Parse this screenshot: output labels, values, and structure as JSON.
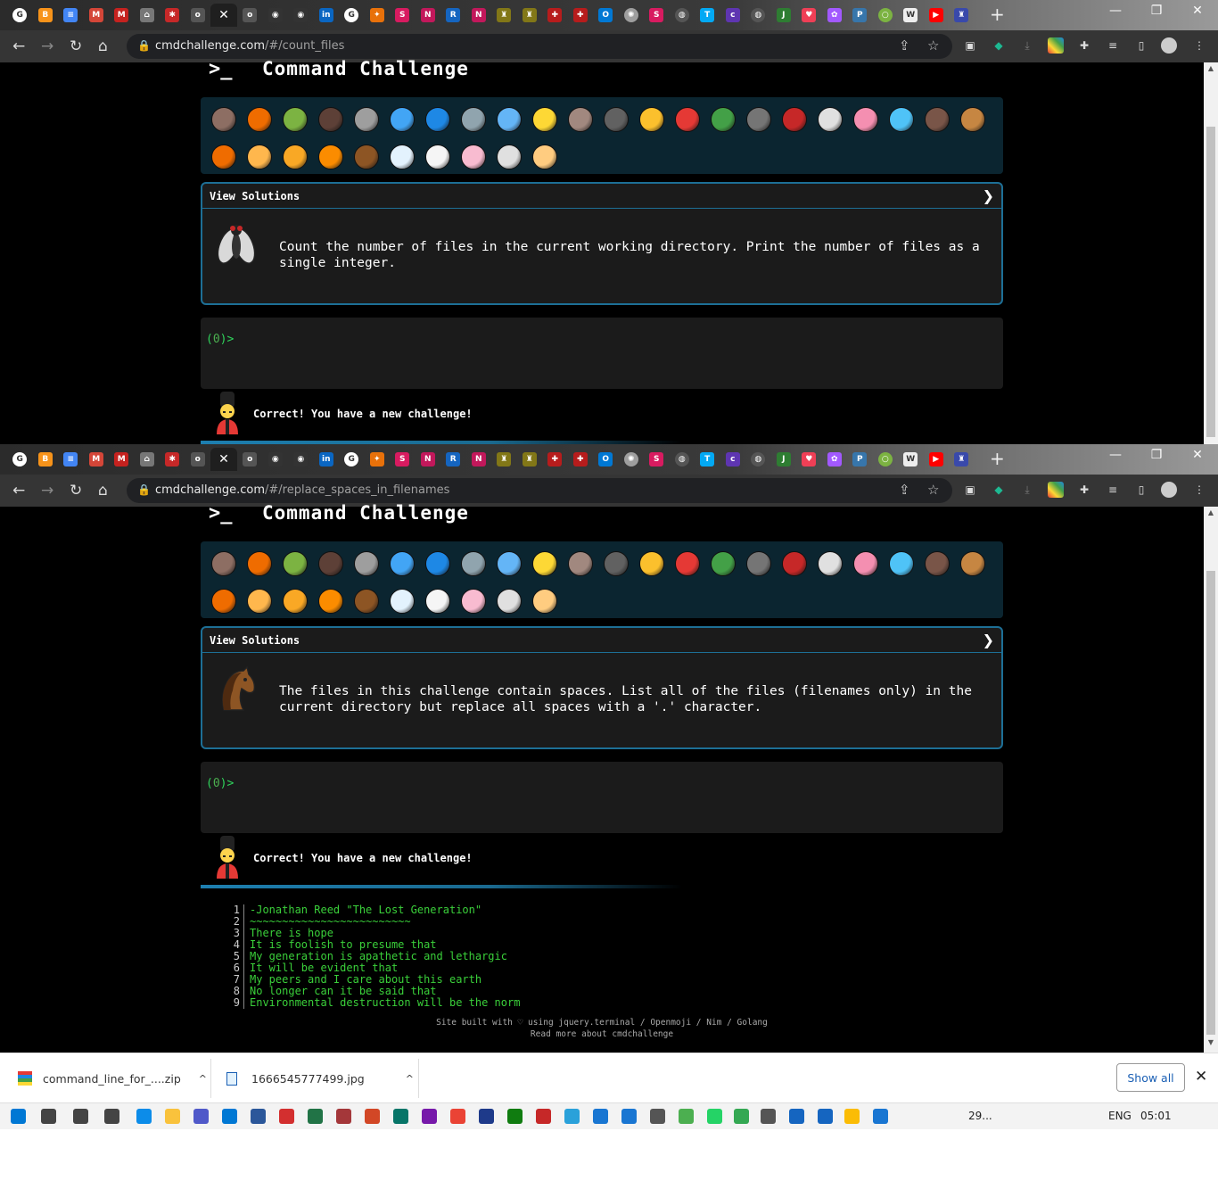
{
  "browser": {
    "tab_close": "✕",
    "new_tab": "+",
    "window_controls": [
      "—",
      "❐",
      "✕"
    ],
    "top_url": {
      "host": "cmdchallenge.com",
      "path": "/#/count_files"
    },
    "bottom_url": {
      "host": "cmdchallenge.com",
      "path": "/#/replace_spaces_in_filenames"
    },
    "tab_favicons": [
      {
        "icon": "google-icon",
        "color": "#ffffff",
        "glyph": "G"
      },
      {
        "icon": "bitcoin-icon",
        "color": "#f7931a",
        "glyph": "B"
      },
      {
        "icon": "docs-icon",
        "color": "#4285f4",
        "glyph": "≡"
      },
      {
        "icon": "gmail-icon",
        "color": "#d44638",
        "glyph": "M"
      },
      {
        "icon": "gmail-icon",
        "color": "#c5221f",
        "glyph": "M"
      },
      {
        "icon": "bank-icon",
        "color": "#777777",
        "glyph": "⌂"
      },
      {
        "icon": "crab-icon",
        "color": "#c62828",
        "glyph": "✱"
      },
      {
        "icon": "olx-icon",
        "color": "#555555",
        "glyph": "o"
      },
      {
        "icon": "olx-icon",
        "color": "#555555",
        "glyph": "o"
      },
      {
        "icon": "github-icon",
        "color": "#333333",
        "glyph": "◉"
      },
      {
        "icon": "github-icon",
        "color": "#333333",
        "glyph": "◉"
      },
      {
        "icon": "linkedin-icon",
        "color": "#0a66c2",
        "glyph": "in"
      },
      {
        "icon": "google-icon",
        "color": "#ffffff",
        "glyph": "G"
      },
      {
        "icon": "fox-icon",
        "color": "#e8710a",
        "glyph": "✦"
      },
      {
        "icon": "shu-icon",
        "color": "#d81b60",
        "glyph": "S"
      },
      {
        "icon": "ntu-icon",
        "color": "#c2185b",
        "glyph": "N"
      },
      {
        "icon": "r-icon",
        "color": "#1565c0",
        "glyph": "R"
      },
      {
        "icon": "ntu-icon",
        "color": "#c2185b",
        "glyph": "N"
      },
      {
        "icon": "crest-icon",
        "color": "#827717",
        "glyph": "♜"
      },
      {
        "icon": "crest-icon",
        "color": "#827717",
        "glyph": "♜"
      },
      {
        "icon": "flag-icon",
        "color": "#b71c1c",
        "glyph": "✚"
      },
      {
        "icon": "shield-icon",
        "color": "#b71c1c",
        "glyph": "✚"
      },
      {
        "icon": "outlook-icon",
        "color": "#0078d4",
        "glyph": "O"
      },
      {
        "icon": "badge-icon",
        "color": "#9e9e9e",
        "glyph": "✺"
      },
      {
        "icon": "shu-icon",
        "color": "#d81b60",
        "glyph": "S"
      },
      {
        "icon": "globe-icon",
        "color": "#555555",
        "glyph": "◍"
      },
      {
        "icon": "t-icon",
        "color": "#03a9f4",
        "glyph": "T"
      },
      {
        "icon": "cobalt-icon",
        "color": "#5e35b1",
        "glyph": "c"
      },
      {
        "icon": "globe-icon",
        "color": "#555555",
        "glyph": "◍"
      },
      {
        "icon": "jiji-icon",
        "color": "#2e7d32",
        "glyph": "J"
      },
      {
        "icon": "pocket-icon",
        "color": "#ef3f56",
        "glyph": "♥"
      },
      {
        "icon": "figma-icon",
        "color": "#a259ff",
        "glyph": "✿"
      },
      {
        "icon": "python-icon",
        "color": "#3776ab",
        "glyph": "P"
      },
      {
        "icon": "ring-icon",
        "color": "#7cb342",
        "glyph": "○"
      },
      {
        "icon": "wiki-icon",
        "color": "#eeeeee",
        "glyph": "W"
      },
      {
        "icon": "youtube-icon",
        "color": "#ff0000",
        "glyph": "▶"
      },
      {
        "icon": "crest-icon",
        "color": "#3949ab",
        "glyph": "♜"
      }
    ]
  },
  "page": {
    "logo": ">_",
    "title": "Command Challenge",
    "view_solutions": "View Solutions",
    "chevron": "❯",
    "top_challenge": "Count the number of files in the current working directory. Print the number of files as a single integer.",
    "bottom_challenge": "The files in this challenge contain spaces. List all of the files (filenames only) in the current directory but replace all spaces with a '.' character.",
    "prompt_open": "(",
    "prompt_num": "0",
    "prompt_close": ")>",
    "status": "Correct! You have a new challenge!",
    "emojis": [
      {
        "name": "snail-icon",
        "c": "#8d6e63"
      },
      {
        "name": "butterfly-icon",
        "c": "#ef6c00"
      },
      {
        "name": "caterpillar-icon",
        "c": "#7cb342"
      },
      {
        "name": "ant-icon",
        "c": "#5d4037"
      },
      {
        "name": "spider-web-icon",
        "c": "#9e9e9e"
      },
      {
        "name": "whale-icon",
        "c": "#42a5f5"
      },
      {
        "name": "dolphin-icon",
        "c": "#1e88e5"
      },
      {
        "name": "shark-icon",
        "c": "#90a4ae"
      },
      {
        "name": "fish-icon",
        "c": "#64b5f6"
      },
      {
        "name": "tropical-fish-icon",
        "c": "#fdd835"
      },
      {
        "name": "blowfish-icon",
        "c": "#a1887f"
      },
      {
        "name": "wolf-icon",
        "c": "#616161"
      },
      {
        "name": "bee-icon",
        "c": "#fbc02d"
      },
      {
        "name": "ladybug-icon",
        "c": "#e53935"
      },
      {
        "name": "cricket-icon",
        "c": "#43a047"
      },
      {
        "name": "mosquito-icon",
        "c": "#757575"
      },
      {
        "name": "scorpion-icon",
        "c": "#c62828"
      },
      {
        "name": "fly-icon",
        "c": "#e0e0e0"
      },
      {
        "name": "worm-icon",
        "c": "#f48fb1"
      },
      {
        "name": "microbe-icon",
        "c": "#4fc3f7"
      },
      {
        "name": "monkey-icon",
        "c": "#795548"
      },
      {
        "name": "dog-icon",
        "c": "#c68642"
      },
      {
        "name": "fox-icon",
        "c": "#ef6c00"
      },
      {
        "name": "cat-icon",
        "c": "#ffb74d"
      },
      {
        "name": "lion-icon",
        "c": "#f9a825"
      },
      {
        "name": "tiger-icon",
        "c": "#fb8c00"
      },
      {
        "name": "horse-icon",
        "c": "#8d5524"
      },
      {
        "name": "unicorn-icon",
        "c": "#e3f2fd"
      },
      {
        "name": "cow-icon",
        "c": "#f5f5f5"
      },
      {
        "name": "pig-icon",
        "c": "#f8bbd0"
      },
      {
        "name": "mouse-icon",
        "c": "#e0e0e0"
      },
      {
        "name": "hamster-icon",
        "c": "#ffcc80"
      }
    ],
    "poem_lines": [
      {
        "n": "1",
        "t": "-Jonathan Reed \"The Lost Generation\""
      },
      {
        "n": "2",
        "t": "~~~~~~~~~~~~~~~~~~~~~~~~~"
      },
      {
        "n": "3",
        "t": "There is hope"
      },
      {
        "n": "4",
        "t": "It is foolish to presume that"
      },
      {
        "n": "5",
        "t": "My generation is apathetic and lethargic"
      },
      {
        "n": "6",
        "t": "It will be evident that"
      },
      {
        "n": "7",
        "t": "My peers and I care about this earth"
      },
      {
        "n": "8",
        "t": "No longer can it be said that"
      },
      {
        "n": "9",
        "t": "Environmental destruction will be the norm"
      }
    ],
    "footer_line1": "Site built with ♡ using jquery.terminal / Openmoji / Nim / Golang",
    "footer_line2": "Read more about cmdchallenge"
  },
  "downloads": {
    "item1": "command_line_for_....zip",
    "item2": "1666545777499.jpg",
    "show_all": "Show all",
    "close": "✕",
    "caret": "^"
  },
  "taskbar": {
    "weather": "29...",
    "lang": "ENG",
    "time": "05:01"
  }
}
